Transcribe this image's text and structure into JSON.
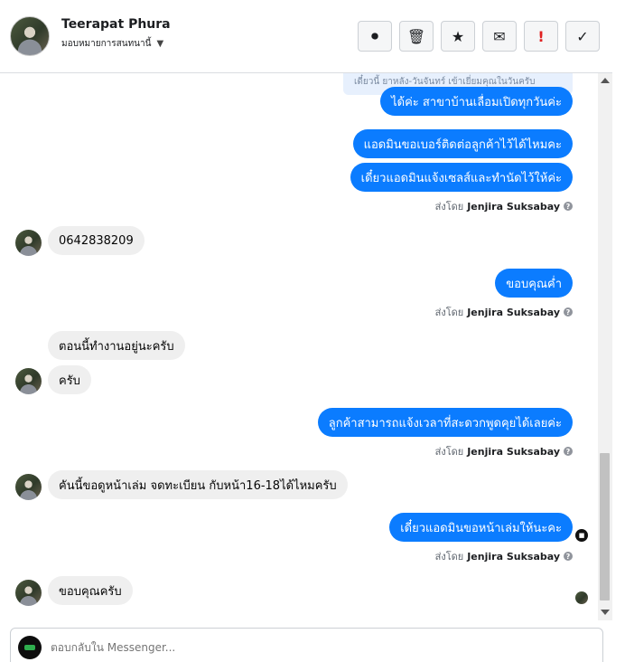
{
  "header": {
    "contact_name": "Teerapat Phura",
    "assign_label": "มอบหมายการสนทนานี้",
    "actions": [
      {
        "icon": "alert-circle-icon",
        "glyph": "⏺"
      },
      {
        "icon": "trash-icon",
        "glyph": "🗑"
      },
      {
        "icon": "star-icon",
        "glyph": "★"
      },
      {
        "icon": "mail-icon",
        "glyph": "✉"
      },
      {
        "icon": "exclamation-icon",
        "glyph": "!"
      },
      {
        "icon": "check-icon",
        "glyph": "✓"
      }
    ]
  },
  "thread": {
    "note_text": "เดี๋ยวนี้ ยาหลัง-วันจันทร์ เข้าเยี่ยมคุณในวันครับ",
    "messages": [
      {
        "dir": "out",
        "text": "ได้ค่ะ สาขาบ้านเลื่อมเปิดทุกวันค่ะ"
      },
      {
        "dir": "out",
        "text": "แอดมินขอเบอร์ติดต่อลูกค้าไว้ได้ไหมคะ"
      },
      {
        "dir": "out",
        "text": "เดี๋ยวแอดมินแจ้งเซลส์และทำนัดไว้ให้ค่ะ"
      },
      {
        "dir": "in",
        "text": "0642838209"
      },
      {
        "dir": "out",
        "text": "ขอบคุณค่ำ"
      },
      {
        "dir": "in",
        "text": "ตอนนี้ทำงานอยู่นะครับ"
      },
      {
        "dir": "in",
        "text": "ครับ"
      },
      {
        "dir": "out",
        "text": "ลูกค้าสามารถแจ้งเวลาที่สะดวกพูดคุยได้เลยค่ะ"
      },
      {
        "dir": "in",
        "text": "คันนี้ขอดูหน้าเล่ม จดทะเบียน กับหน้า16-18ได้ไหมครับ"
      },
      {
        "dir": "out",
        "text": "เดี๋ยวแอดมินขอหน้าเล่มให้นะคะ"
      },
      {
        "dir": "in",
        "text": "ขอบคุณครับ"
      }
    ],
    "sent_by_prefix": "ส่งโดย",
    "sent_by_name": "Jenjira Suksabay",
    "info_glyph": "?"
  },
  "composer": {
    "placeholder": "ตอบกลับใน Messenger..."
  }
}
